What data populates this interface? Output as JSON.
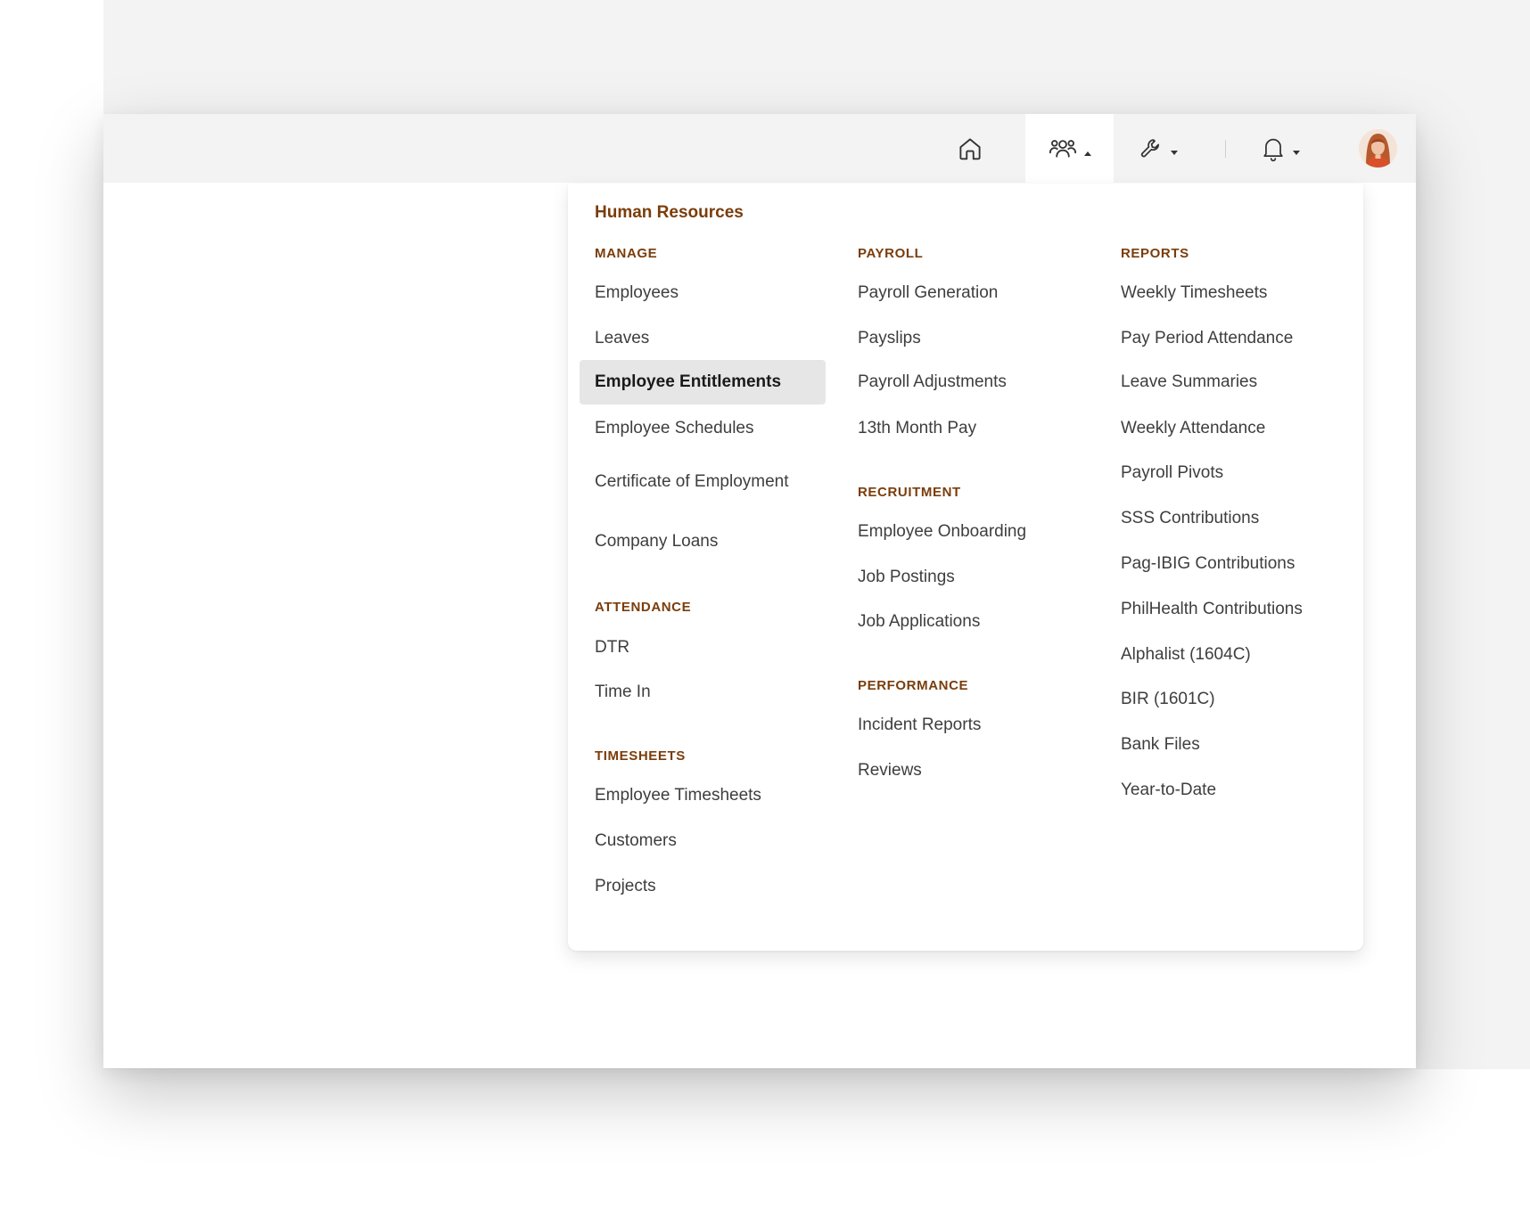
{
  "nav": {
    "home_icon": "home-icon",
    "hr_icon": "users-icon",
    "tools_icon": "wrench-icon",
    "notifications_icon": "bell-icon",
    "accent_color": "#7a3d0b"
  },
  "menu": {
    "title": "Human Resources",
    "manage": {
      "heading": "MANAGE",
      "items": [
        "Employees",
        "Leaves",
        "Employee Entitlements",
        "Employee Schedules",
        "Certificate of Employment",
        "Company Loans"
      ],
      "active": "Employee Entitlements"
    },
    "attendance": {
      "heading": "ATTENDANCE",
      "items": [
        "DTR",
        "Time In"
      ]
    },
    "timesheets": {
      "heading": "TIMESHEETS",
      "items": [
        "Employee Timesheets",
        "Customers",
        "Projects"
      ]
    },
    "payroll": {
      "heading": "PAYROLL",
      "items": [
        "Payroll Generation",
        "Payslips",
        "Payroll Adjustments",
        "13th Month Pay"
      ]
    },
    "recruitment": {
      "heading": "RECRUITMENT",
      "items": [
        "Employee Onboarding",
        "Job Postings",
        "Job Applications"
      ]
    },
    "performance": {
      "heading": "PERFORMANCE",
      "items": [
        "Incident Reports",
        "Reviews"
      ]
    },
    "reports": {
      "heading": "REPORTS",
      "items": [
        "Weekly Timesheets",
        "Pay Period Attendance",
        "Leave Summaries",
        "Weekly Attendance",
        "Payroll Pivots",
        "SSS Contributions",
        "Pag-IBIG Contributions",
        "PhilHealth Contributions",
        "Alphalist (1604C)",
        "BIR (1601C)",
        "Bank Files",
        "Year-to-Date"
      ]
    }
  }
}
